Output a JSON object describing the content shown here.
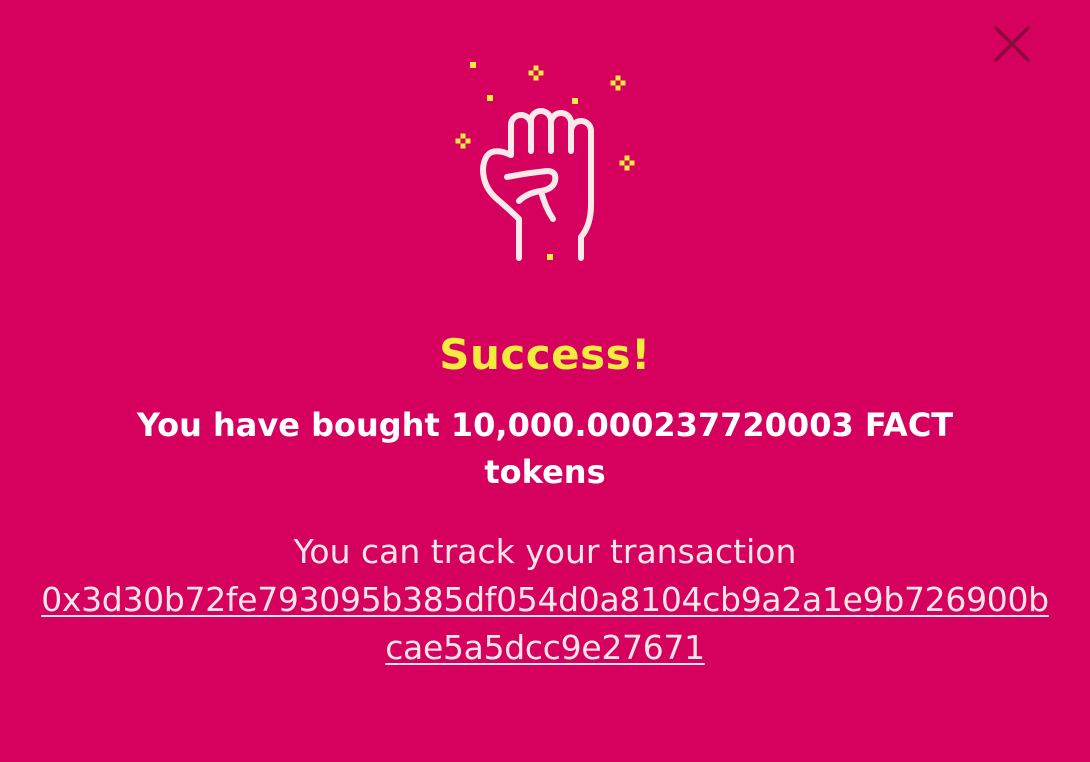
{
  "dialog": {
    "title": "Success!",
    "message": "You have bought 10,000.000237720003 FACT tokens",
    "track_label": "You can track your transaction",
    "transaction_hash": "0x3d30b72fe793095b385df054d0a8104cb9a2a1e9b726900bcae5a5dcc9e27671",
    "icons": {
      "close": "close-icon",
      "hero": "raised-fist-icon"
    }
  },
  "colors": {
    "background": "#d6005f",
    "title": "#f3ec3e",
    "text": "#ffffff",
    "sparkle": "#f3ec3e",
    "icon_stroke": "#fbe9e9",
    "close_icon": "#8c0a3e"
  }
}
